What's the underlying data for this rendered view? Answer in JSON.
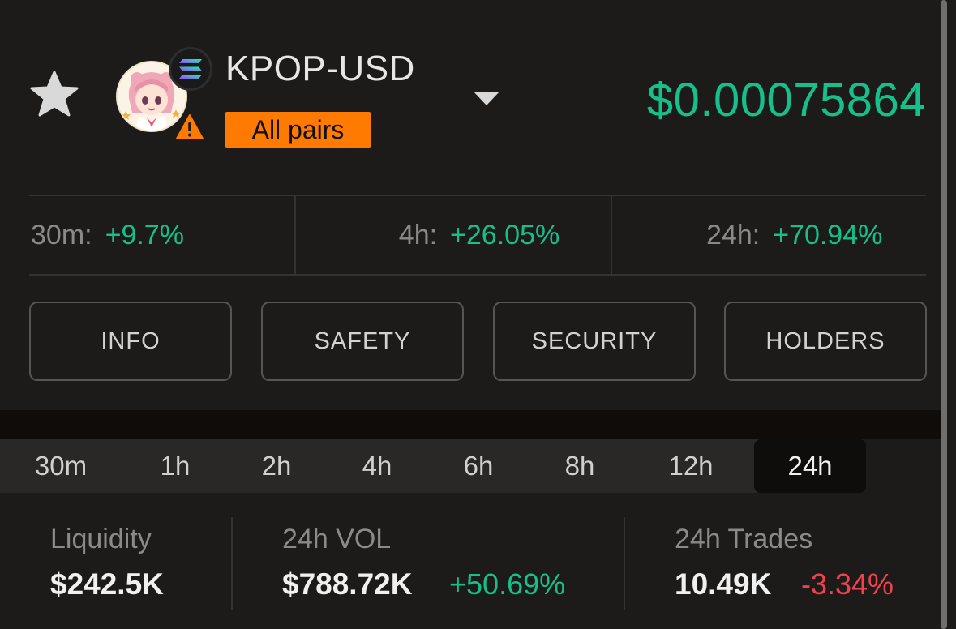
{
  "header": {
    "pair_name": "KPOP-USD",
    "pairs_badge": "All pairs",
    "price": "$0.00075864",
    "icons": {
      "favorite": "star-icon",
      "token": "token-avatar-icon",
      "chain": "solana-icon",
      "warning": "warning-icon",
      "dropdown": "chevron-down-icon"
    }
  },
  "changes": [
    {
      "label": "30m:",
      "value": "+9.7%"
    },
    {
      "label": "4h:",
      "value": "+26.05%"
    },
    {
      "label": "24h:",
      "value": "+70.94%"
    }
  ],
  "buttons": [
    "INFO",
    "SAFETY",
    "SECURITY",
    "HOLDERS"
  ],
  "timeframes": {
    "tabs": [
      "30m",
      "1h",
      "2h",
      "4h",
      "6h",
      "8h",
      "12h",
      "24h"
    ],
    "selected": "24h"
  },
  "stats": {
    "liquidity": {
      "label": "Liquidity",
      "value": "$242.5K"
    },
    "volume": {
      "label": "24h VOL",
      "value": "$788.72K",
      "change": "+50.69%"
    },
    "trades": {
      "label": "24h Trades",
      "value": "10.49K",
      "change": "-3.34%"
    }
  },
  "colors": {
    "positive": "#15c08a",
    "negative": "#f0424e",
    "badge": "#ff7a00",
    "background": "#1c1b1a"
  }
}
